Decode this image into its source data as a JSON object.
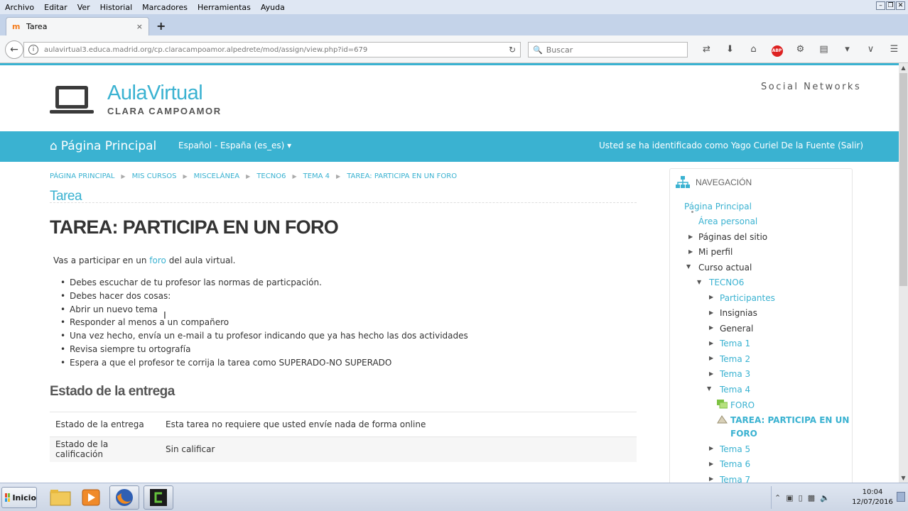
{
  "browser": {
    "menu": [
      "Archivo",
      "Editar",
      "Ver",
      "Historial",
      "Marcadores",
      "Herramientas",
      "Ayuda"
    ],
    "tab_title": "Tarea",
    "tab_close": "×",
    "new_tab": "+",
    "url": "aulavirtual3.educa.madrid.org/cp.claracampoamor.alpedrete/mod/assign/view.php?id=679",
    "search_placeholder": "Buscar",
    "abp_label": "ABP"
  },
  "site": {
    "logo_title": "AulaVirtual",
    "logo_subtitle": "CLARA CAMPOAMOR",
    "social": "Social Networks",
    "home_link": "Página Principal",
    "language": "Español - España (es_es)",
    "language_caret": "▾",
    "user_info": "Usted se ha identificado como Yago Curiel De la Fuente (Salir)"
  },
  "breadcrumb": [
    "PÁGINA PRINCIPAL",
    "MIS CURSOS",
    "MISCELÁNEA",
    "TECNO6",
    "TEMA 4",
    "TAREA: PARTICIPA EN UN FORO"
  ],
  "breadcrumb_sep": "▶",
  "content": {
    "section_label": "Tarea",
    "title": "TAREA: PARTICIPA EN UN FORO",
    "intro_before": "Vas a participar en un ",
    "intro_link": "foro",
    "intro_after": " del aula virtual.",
    "bullets": [
      "Debes escuchar de tu profesor las normas de particpación.",
      "Debes hacer dos cosas:",
      "Abrir un nuevo tema",
      "Responder al menos a un compañero",
      "Una vez hecho, envía un e-mail a tu profesor indicando que ya has hecho las dos actividades",
      "Revisa siempre tu ortografía",
      "Espera a que el profesor te corrija la tarea como SUPERADO-NO SUPERADO"
    ],
    "status_heading": "Estado de la entrega",
    "status_rows": [
      {
        "label": "Estado de la entrega",
        "value": "Esta tarea no requiere que usted envíe nada de forma online"
      },
      {
        "label": "Estado de la calificación",
        "value": "Sin calificar"
      }
    ]
  },
  "navigation": {
    "title": "NAVEGACIÓN",
    "items": [
      {
        "label": "Página Principal"
      },
      {
        "label": "Área personal"
      },
      {
        "label": "Páginas del sitio"
      },
      {
        "label": "Mi perfil"
      },
      {
        "label": "Curso actual"
      },
      {
        "label": "TECNO6"
      },
      {
        "label": "Participantes"
      },
      {
        "label": "Insignias"
      },
      {
        "label": "General"
      },
      {
        "label": "Tema 1"
      },
      {
        "label": "Tema 2"
      },
      {
        "label": "Tema 3"
      },
      {
        "label": "Tema 4"
      },
      {
        "label": "FORO"
      },
      {
        "label": "TAREA: PARTICIPA EN UN"
      },
      {
        "label": "FORO"
      },
      {
        "label": "Tema 5"
      },
      {
        "label": "Tema 6"
      },
      {
        "label": "Tema 7"
      }
    ]
  },
  "taskbar": {
    "start": "Inicio",
    "time": "10:04",
    "date": "12/07/2016"
  },
  "colors": {
    "accent": "#3ab2d1"
  }
}
